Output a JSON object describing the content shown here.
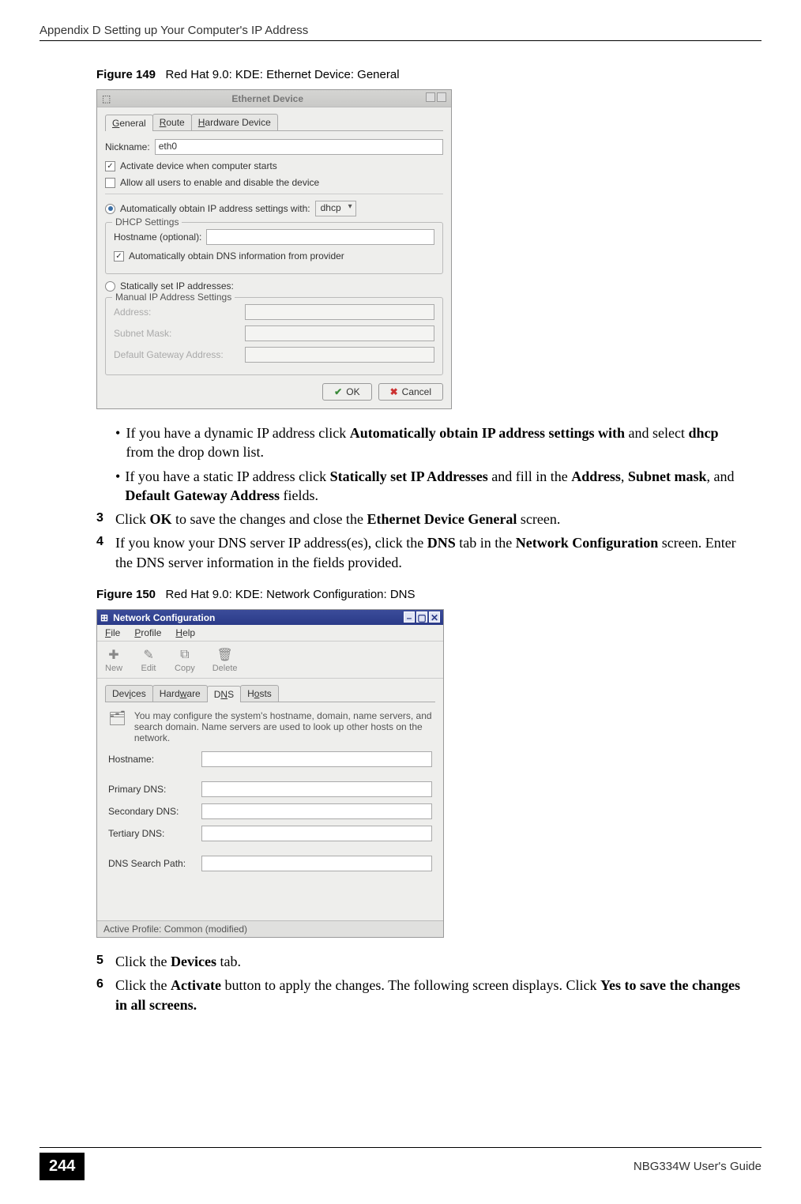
{
  "header_left": "Appendix D Setting up Your Computer's IP Address",
  "fig149": {
    "label": "Figure 149",
    "caption": "Red Hat 9.0: KDE: Ethernet Device: General"
  },
  "dlg1": {
    "title": "Ethernet Device",
    "tabs": {
      "general_g": "G",
      "general_rest": "eneral",
      "route_r": "R",
      "route_rest": "oute",
      "hw_h": "H",
      "hw_rest": "ardware Device"
    },
    "nick_n": "N",
    "nick_rest": "ickname:",
    "nick_val": "eth0",
    "activate_a": "A",
    "activate_rest": "ctivate device when computer starts",
    "allow_u": "u",
    "allow_pre": "Allow all ",
    "allow_rest": "sers to enable and disable the device",
    "auto_i": "I",
    "auto_pre": "Automatically obtain ",
    "auto_rest": "P address settings with:",
    "auto_sel": "dhcp",
    "dhcp_legend": "DHCP Settings",
    "host_h": "H",
    "host_rest": "ostname (optional):",
    "autodns_d": "D",
    "autodns_pre": "Automatically obtain ",
    "autodns_rest": "NS information from provider",
    "static_s": "S",
    "static_pre": "",
    "static_rest": "tatically set IP addresses:",
    "manual_legend": "Manual IP Address Settings",
    "addr_a": "A",
    "addr_rest": "ddress:",
    "snm_s": "S",
    "snm_rest": "ubnet Mask:",
    "gw_g": "G",
    "gw_pre": "Default ",
    "gw_rest": "ateway Address:",
    "ok_o": "O",
    "ok_rest": "K",
    "cancel_c": "C",
    "cancel_rest": "ancel"
  },
  "bullets": {
    "b1a": "If you have a dynamic IP address click ",
    "b1b": "Automatically obtain IP address settings with",
    "b1c": " and select ",
    "b1d": "dhcp",
    "b1e": " from the drop down list.",
    "b2a": "If you have a static IP address click ",
    "b2b": "Statically set IP Addresses",
    "b2c": " and fill in the ",
    "b2d": "Address",
    "b2e": ", ",
    "b2f": "Subnet mask",
    "b2g": ", and ",
    "b2h": "Default Gateway Address",
    "b2i": " fields."
  },
  "steps": {
    "s3n": "3",
    "s3a": "Click ",
    "s3b": "OK",
    "s3c": " to save the changes and close the ",
    "s3d": "Ethernet Device General",
    "s3e": " screen.",
    "s4n": "4",
    "s4a": "If you know your DNS server IP address(es), click the ",
    "s4b": "DNS",
    "s4c": " tab in the ",
    "s4d": "Network Configuration",
    "s4e": " screen. Enter the DNS server information in the fields provided.",
    "s5n": "5",
    "s5a": "Click the ",
    "s5b": "Devices",
    "s5c": " tab.",
    "s6n": "6",
    "s6a": "Click the ",
    "s6b": "Activate",
    "s6c": " button to apply the changes. The following screen displays. Click ",
    "s6d": "Yes",
    "s6e": " ",
    "s6f": "to save the changes in all screens."
  },
  "fig150": {
    "label": "Figure 150",
    "caption": "Red Hat 9.0: KDE: Network Configuration: DNS"
  },
  "dlg2": {
    "title": "Network Configuration",
    "menu": {
      "file_f": "F",
      "file_rest": "ile",
      "profile_p": "P",
      "profile_rest": "rofile",
      "help_h": "H",
      "help_rest": "elp"
    },
    "tb": {
      "new_n": "N",
      "new_rest": "ew",
      "edit_e": "E",
      "edit_rest": "dit",
      "copy_c": "C",
      "copy_rest": "opy",
      "del_d": "D",
      "del_rest": "elete"
    },
    "tabs2": {
      "dev_i": "i",
      "dev_pre": "Dev",
      "dev_rest": "ces",
      "hw_w": "w",
      "hw_pre": "Hard",
      "hw_rest": "are",
      "dns_n": "N",
      "dns_pre": "D",
      "dns_rest": "S",
      "hosts_o": "o",
      "hosts_pre": "H",
      "hosts_rest": "sts"
    },
    "desc": "You may configure the system's hostname, domain, name servers, and search domain. Name servers are used to look up other hosts on the network.",
    "hostname_h": "H",
    "hostname_rest": "ostname:",
    "pdns_p": "P",
    "pdns_rest": "rimary DNS:",
    "sdns_s": "S",
    "sdns_rest": "econdary DNS:",
    "tdns_t": "T",
    "tdns_rest": "ertiary DNS:",
    "search": "DNS Search Path:",
    "status": "Active Profile: Common (modified)"
  },
  "footer": {
    "page": "244",
    "guide": "NBG334W User's Guide"
  }
}
